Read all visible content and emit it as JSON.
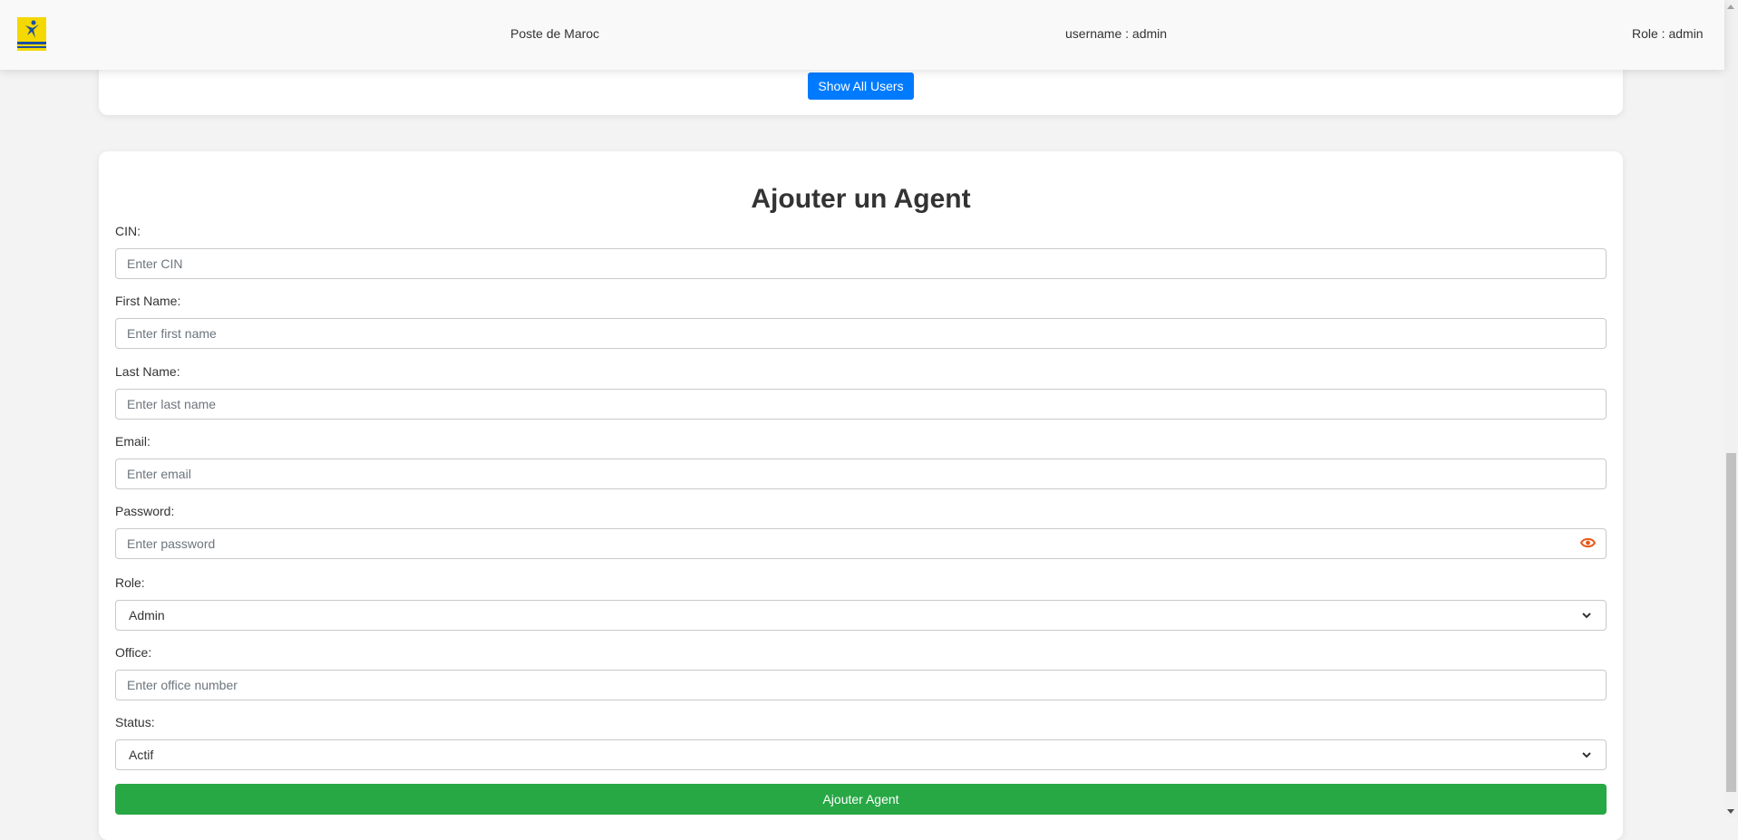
{
  "header": {
    "brand": "Poste de Maroc",
    "username": "username : admin",
    "role": "Role : admin"
  },
  "top_card": {
    "show_all_users_label": "Show All Users"
  },
  "form": {
    "title": "Ajouter un Agent",
    "fields": {
      "cin": {
        "label": "CIN:",
        "placeholder": "Enter CIN"
      },
      "first_name": {
        "label": "First Name:",
        "placeholder": "Enter first name"
      },
      "last_name": {
        "label": "Last Name:",
        "placeholder": "Enter last name"
      },
      "email": {
        "label": "Email:",
        "placeholder": "Enter email"
      },
      "password": {
        "label": "Password:",
        "placeholder": "Enter password"
      },
      "role": {
        "label": "Role:",
        "selected": "Admin"
      },
      "office": {
        "label": "Office:",
        "placeholder": "Enter office number"
      },
      "status": {
        "label": "Status:",
        "selected": "Actif"
      }
    },
    "submit_label": "Ajouter Agent"
  },
  "icons": {
    "logo": "poste-maroc-logo",
    "password_toggle": "eye-icon",
    "select_arrow": "chevron-down-icon"
  },
  "colors": {
    "primary_button": "#007bff",
    "submit_button": "#28a745",
    "eye_icon": "#e8591a",
    "logo_yellow": "#f4d800",
    "logo_blue": "#1c4fa0"
  }
}
